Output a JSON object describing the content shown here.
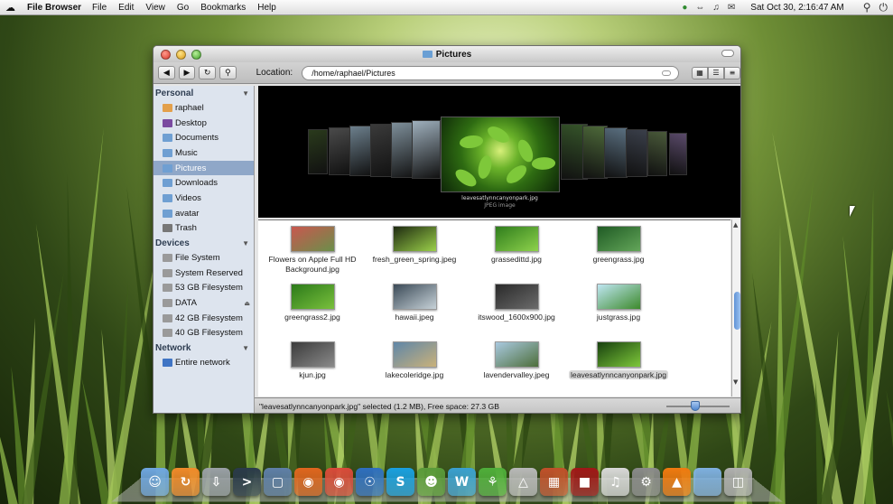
{
  "menubar": {
    "app_name": "File Browser",
    "menus": [
      "File",
      "Edit",
      "View",
      "Go",
      "Bookmarks",
      "Help"
    ],
    "clock": "Sat Oct 30,  2:16:47 AM",
    "status_icons": [
      "network-icon",
      "transfer-icon",
      "volume-icon",
      "mail-icon",
      "search-icon",
      "power-icon"
    ]
  },
  "window": {
    "title": "Pictures",
    "location_label": "Location:",
    "location_value": "/home/raphael/Pictures"
  },
  "sidebar": {
    "sections": [
      {
        "title": "Personal",
        "items": [
          "raphael",
          "Desktop",
          "Documents",
          "Music",
          "Pictures",
          "Downloads",
          "Videos",
          "avatar",
          "Trash"
        ]
      },
      {
        "title": "Devices",
        "items": [
          "File System",
          "System Reserved",
          "53 GB Filesystem",
          "DATA",
          "42 GB Filesystem",
          "40 GB Filesystem"
        ]
      },
      {
        "title": "Network",
        "items": [
          "Entire network"
        ]
      }
    ],
    "selected": "Pictures"
  },
  "coverflow": {
    "caption": "leavesatlynncanyonpark.jpg",
    "subcaption": "JPEG image"
  },
  "files": [
    {
      "name": "Flowers on Apple Full HD Background.jpg",
      "colors": [
        "#c9574f",
        "#6a8f4a"
      ]
    },
    {
      "name": "fresh_green_spring.jpeg",
      "colors": [
        "#1e2a10",
        "#9bd04a"
      ]
    },
    {
      "name": "grassedittd.jpg",
      "colors": [
        "#2f7d1c",
        "#8ed24c"
      ]
    },
    {
      "name": "greengrass.jpg",
      "colors": [
        "#1f5a24",
        "#63a659"
      ]
    },
    {
      "name": "greengrass2.jpg",
      "colors": [
        "#2c7a1a",
        "#79c03c"
      ]
    },
    {
      "name": "hawaii.jpeg",
      "colors": [
        "#3b4a57",
        "#c7d2d8"
      ]
    },
    {
      "name": "itswood_1600x900.jpg",
      "colors": [
        "#2a2a2a",
        "#6b6b6b"
      ]
    },
    {
      "name": "justgrass.jpg",
      "colors": [
        "#bfe6f2",
        "#3d8a2c"
      ]
    },
    {
      "name": "kjun.jpg",
      "colors": [
        "#3b3b3b",
        "#8a8a8a"
      ]
    },
    {
      "name": "lakecoleridge.jpg",
      "colors": [
        "#5f86a8",
        "#c9b17a"
      ]
    },
    {
      "name": "lavendervalley.jpeg",
      "colors": [
        "#a9c9e0",
        "#4d6e3a"
      ]
    },
    {
      "name": "leavesatlynncanyonpark.jpg",
      "colors": [
        "#17400e",
        "#7ec83a"
      ]
    }
  ],
  "selected_file": "leavesatlynncanyonpark.jpg",
  "statusbar": {
    "text": "\"leavesatlynncanyonpark.jpg\" selected (1.2 MB), Free space: 27.3 GB",
    "zoom_level": 0.45
  },
  "dock": {
    "icons": [
      "finder-icon",
      "update-icon",
      "download-icon",
      "terminal-icon",
      "preview-icon",
      "firefox-icon",
      "chrome-icon",
      "network-globe-icon",
      "skype-icon",
      "pidgin-icon",
      "text-editor-icon",
      "plant-icon",
      "games-icon",
      "photos-icon",
      "photobooth-icon",
      "itunes-icon",
      "system-prefs-icon",
      "vlc-icon",
      "folder-icon",
      "trash-icon"
    ]
  }
}
